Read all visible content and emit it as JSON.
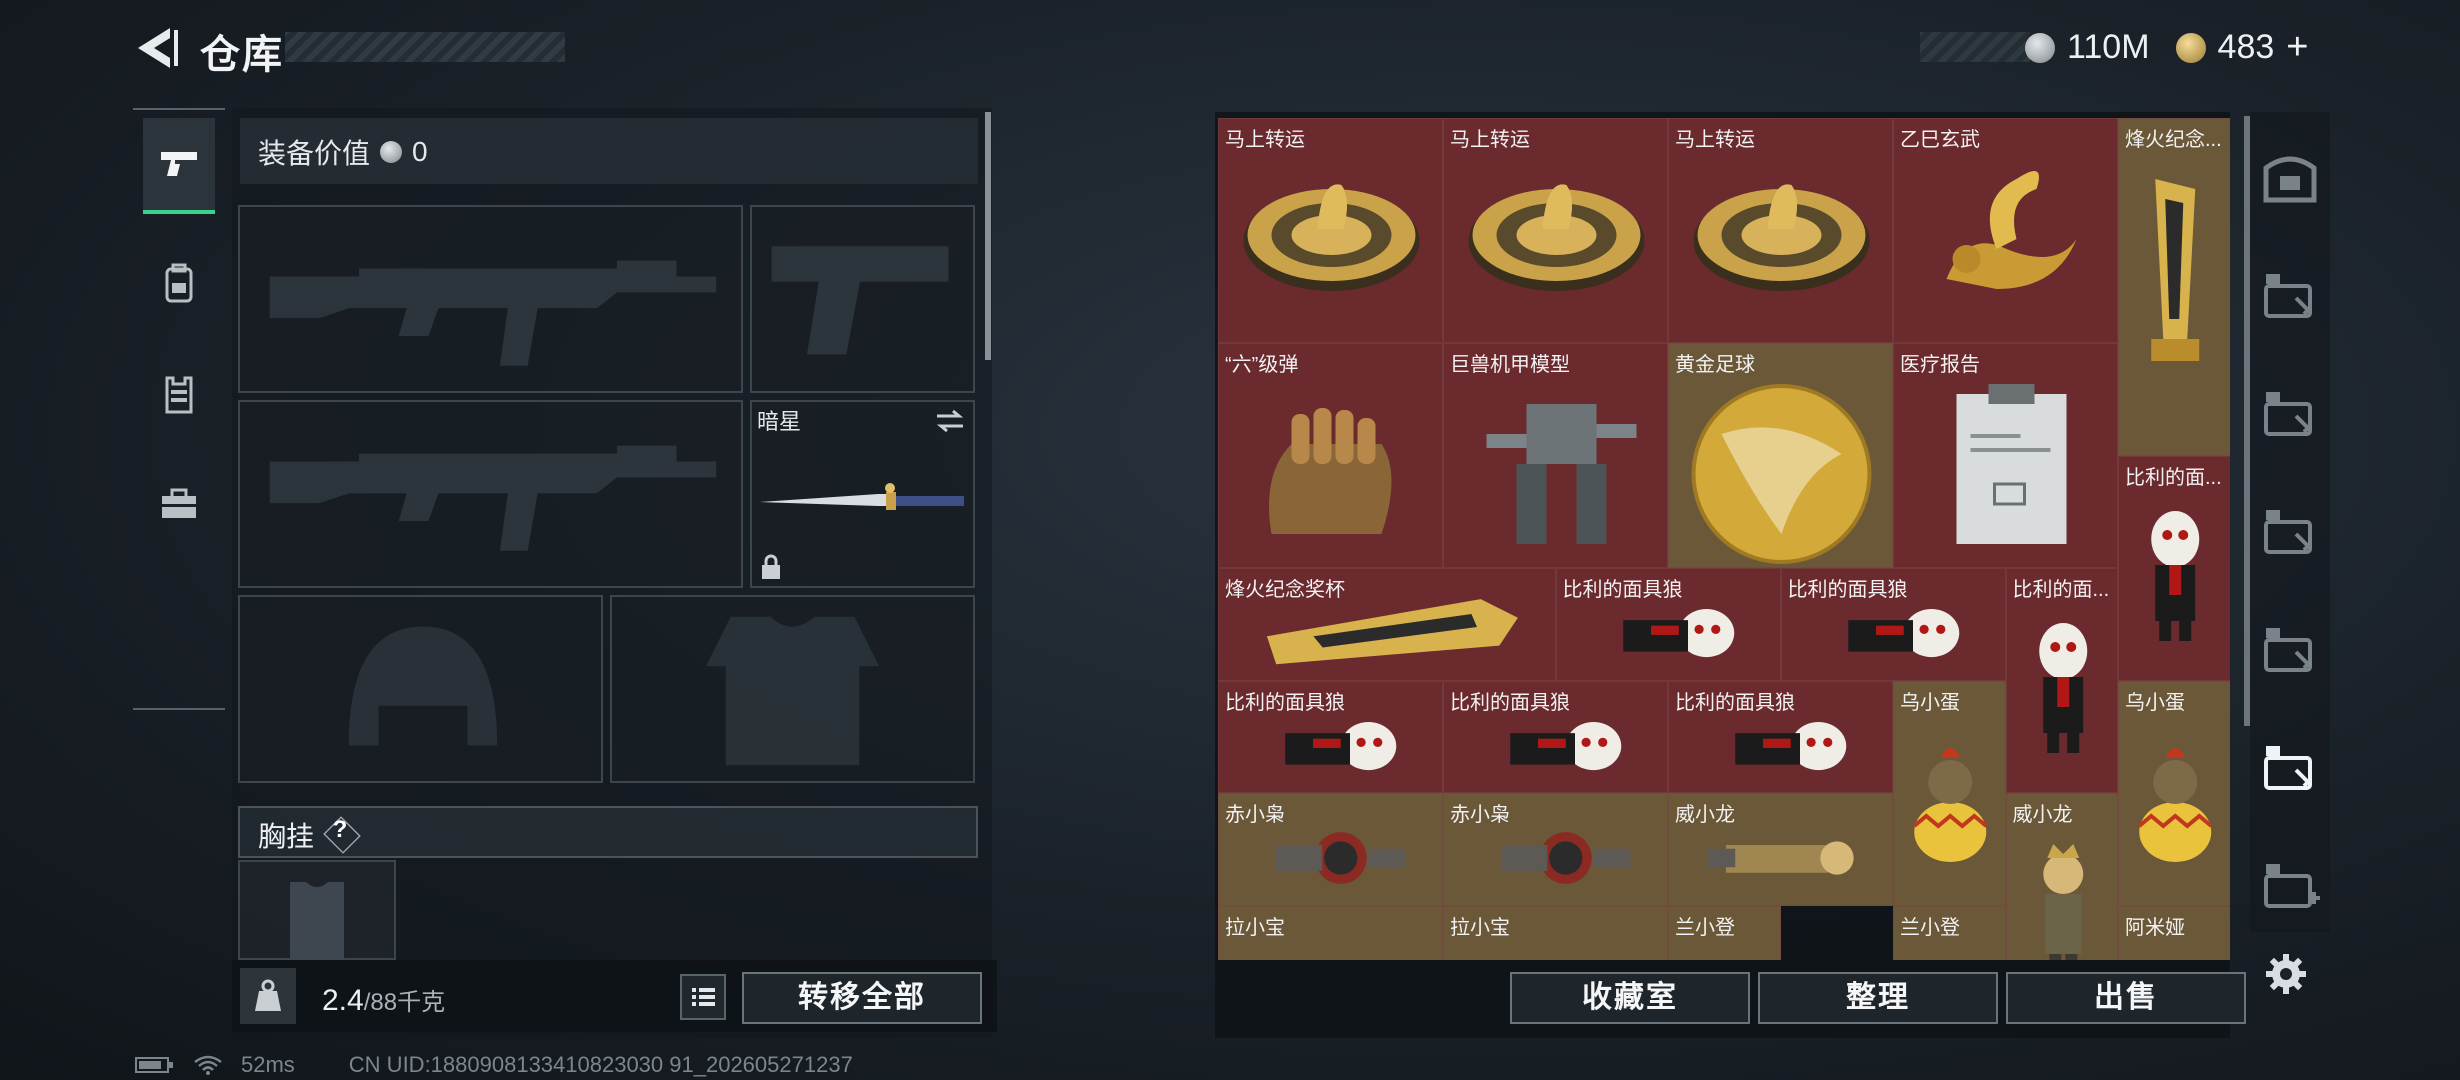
{
  "header": {
    "title": "仓库",
    "currency_silver": "110M",
    "currency_gold": "483",
    "add_label": "+"
  },
  "loadout": {
    "value_label": "装备价值",
    "value_amount": "0",
    "darkstar_label": "暗星",
    "chest_label": "胸挂",
    "chest_help": "?"
  },
  "bottom_left": {
    "weight_current": "2.4",
    "weight_max": "/88千克",
    "transfer_all": "转移全部"
  },
  "grid": {
    "items": [
      {
        "name": "马上转运",
        "art": "coin-wheel"
      },
      {
        "name": "马上转运",
        "art": "coin-wheel"
      },
      {
        "name": "马上转运",
        "art": "coin-wheel"
      },
      {
        "name": "乙巳玄武",
        "art": "gold-dragon"
      },
      {
        "name": "烽火纪念...",
        "art": "gold-trophy"
      },
      {
        "name": "“六”级弹",
        "art": "bullet-hand"
      },
      {
        "name": "巨兽机甲模型",
        "art": "mech"
      },
      {
        "name": "黄金足球",
        "art": "gold-ball"
      },
      {
        "name": "医疗报告",
        "art": "clipboard"
      },
      {
        "name": "比利的面...",
        "art": "puppet"
      },
      {
        "name": "烽火纪念奖杯",
        "art": "gold-trophy-long"
      },
      {
        "name": "比利的面具狼",
        "art": "puppet-lying"
      },
      {
        "name": "比利的面具狼",
        "art": "puppet-lying"
      },
      {
        "name": "比利的面...",
        "art": "puppet"
      },
      {
        "name": "比利的面具狼",
        "art": "puppet-lying"
      },
      {
        "name": "比利的面具狼",
        "art": "puppet-lying"
      },
      {
        "name": "比利的面具狼",
        "art": "puppet-lying"
      },
      {
        "name": "乌小蛋",
        "art": "egg-bird"
      },
      {
        "name": "乌小蛋",
        "art": "egg-bird"
      },
      {
        "name": "赤小枭",
        "art": "owl"
      },
      {
        "name": "赤小枭",
        "art": "owl"
      },
      {
        "name": "威小龙",
        "art": "lying-figure"
      },
      {
        "name": "威小龙",
        "art": "figure"
      },
      {
        "name": "拉小宝",
        "art": "partial"
      },
      {
        "name": "拉小宝",
        "art": "partial"
      },
      {
        "name": "兰小登",
        "art": "partial"
      },
      {
        "name": "兰小登",
        "art": "partial"
      },
      {
        "name": "阿米娅",
        "art": "partial"
      }
    ]
  },
  "bottom_right": {
    "collection": "收藏室",
    "sort": "整理",
    "sell": "出售"
  },
  "status": {
    "ping": "52ms",
    "uid": "CN UID:1880908133410823030 91_202605271237"
  },
  "colors": {
    "accent_green": "#3bd28e",
    "cell_red": "#6a2a2e",
    "cell_gold": "#6b5839"
  },
  "icons": {
    "back": "back-arrow-icon",
    "rail": [
      "pistol-icon",
      "backpack-icon",
      "vest-icon",
      "toolbox-icon"
    ],
    "right_tabs": [
      "safe-icon",
      "case-v-icon",
      "case-iv-icon",
      "case-iv-icon",
      "case-iv-icon",
      "case-iv-icon",
      "case-iv-add-icon"
    ],
    "settings": "gear-icon"
  }
}
